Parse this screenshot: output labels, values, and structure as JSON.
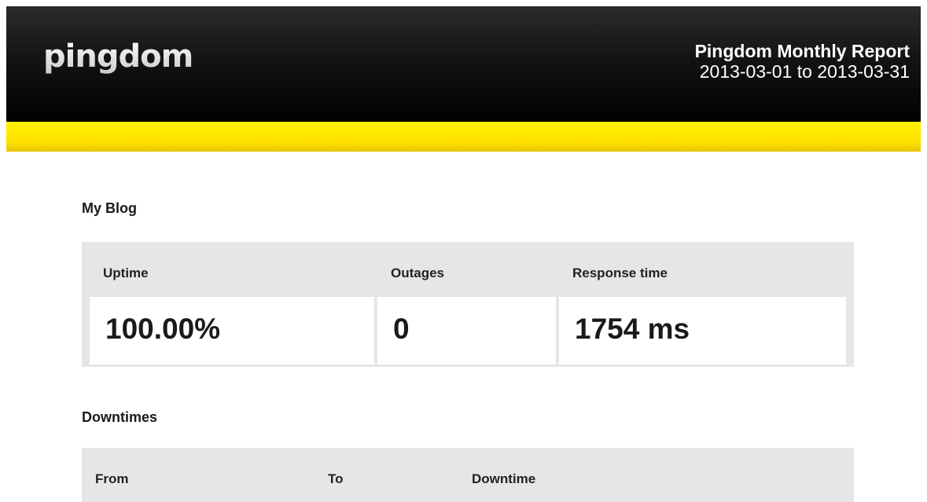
{
  "header": {
    "logo_text": "pingdom",
    "report_title": "Pingdom Monthly Report",
    "date_range": "2013-03-01 to 2013-03-31"
  },
  "check": {
    "name": "My Blog",
    "stats": [
      {
        "label": "Uptime",
        "value": "100.00%"
      },
      {
        "label": "Outages",
        "value": "0"
      },
      {
        "label": "Response time",
        "value": "1754 ms"
      }
    ]
  },
  "downtimes": {
    "title": "Downtimes",
    "columns": [
      "From",
      "To",
      "Downtime"
    ]
  },
  "colors": {
    "header_bg": "#000000",
    "accent_yellow": "#ffe600",
    "panel_gray": "#e6e6e6"
  }
}
